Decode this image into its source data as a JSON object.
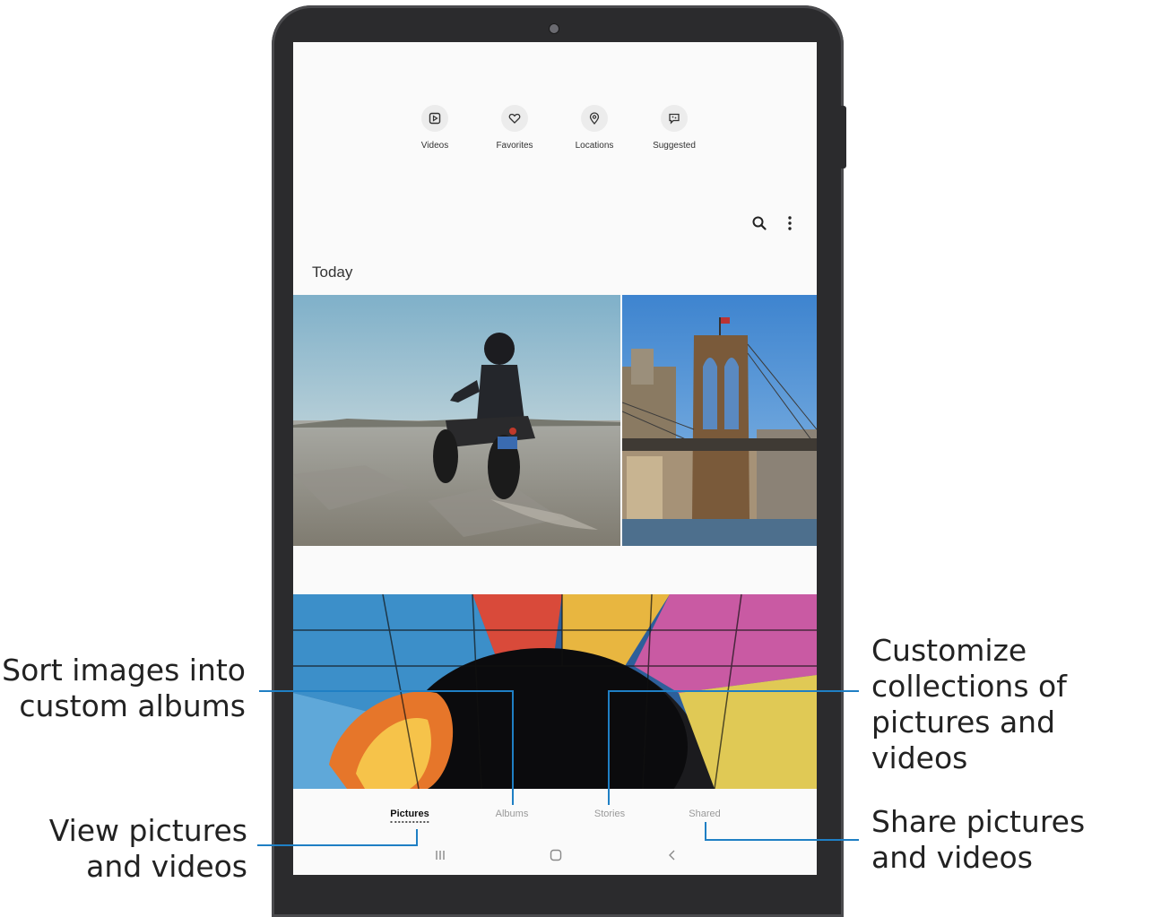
{
  "gallery": {
    "quick_categories": [
      {
        "label": "Videos",
        "icon": "play-square-icon"
      },
      {
        "label": "Favorites",
        "icon": "heart-icon"
      },
      {
        "label": "Locations",
        "icon": "location-pin-icon"
      },
      {
        "label": "Suggested",
        "icon": "suggested-chat-icon"
      }
    ],
    "section_title": "Today",
    "toolbar": {
      "search_icon": "search-icon",
      "more_icon": "more-vertical-icon"
    },
    "tabs": [
      {
        "label": "Pictures",
        "active": true
      },
      {
        "label": "Albums",
        "active": false
      },
      {
        "label": "Stories",
        "active": false
      },
      {
        "label": "Shared",
        "active": false
      }
    ],
    "system_nav": {
      "recents": "recents-icon",
      "home": "home-icon",
      "back": "back-icon"
    }
  },
  "callouts": {
    "albums": "Sort images into\ncustom albums",
    "pictures": "View pictures\nand videos",
    "stories": "Customize\ncollections of\npictures and videos",
    "shared": "Share pictures\nand videos"
  },
  "colors": {
    "callout_line": "#1f7fc4",
    "device_frame": "#2b2b2d"
  }
}
